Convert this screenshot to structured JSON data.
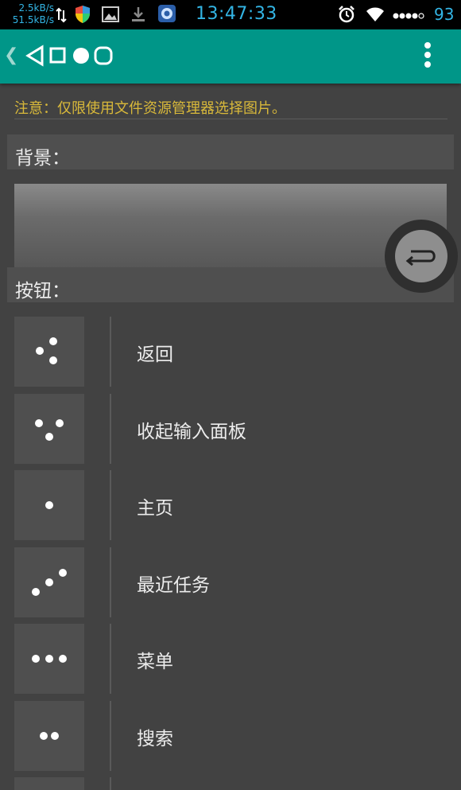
{
  "status_bar": {
    "upload_speed": "2.5kB/s",
    "download_speed": "51.5kB/s",
    "time": "13:47:33",
    "battery": "93"
  },
  "action_bar": {
    "nav_glyphs": "◁□●○"
  },
  "notice": "注意：仅限使用文件资源管理器选择图片。",
  "background_section": {
    "label": "背景："
  },
  "buttons_section": {
    "label": "按钮：",
    "items": [
      {
        "label": "返回",
        "icon": "back-dots-icon"
      },
      {
        "label": "收起输入面板",
        "icon": "hide-keyboard-dots-icon"
      },
      {
        "label": "主页",
        "icon": "home-dot-icon"
      },
      {
        "label": "最近任务",
        "icon": "recent-tasks-dots-icon"
      },
      {
        "label": "菜单",
        "icon": "menu-dots-icon"
      },
      {
        "label": "搜索",
        "icon": "search-dots-icon"
      }
    ]
  },
  "colors": {
    "accent": "#009688",
    "notice": "#d9b93a",
    "status_blue": "#33b5e5",
    "background": "#424242"
  }
}
